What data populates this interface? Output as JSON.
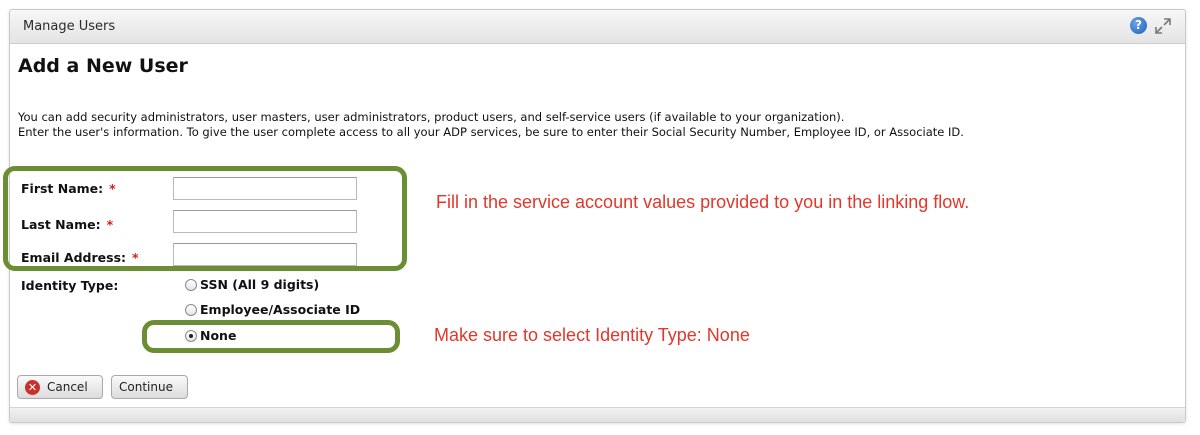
{
  "panel": {
    "title": "Manage Users"
  },
  "icons": {
    "help": "question-circle-icon",
    "expand": "expand-arrows-icon",
    "cancel": "x-circle-icon"
  },
  "page": {
    "heading": "Add a New User",
    "intro_line1": "You can add security administrators, user masters, user administrators, product users, and self-service users (if available to your organization).",
    "intro_line2": "Enter the user's information. To give the user complete access to all your ADP services, be sure to enter their Social Security Number, Employee ID, or Associate ID."
  },
  "form": {
    "first_name": {
      "label": "First Name:",
      "required": "*",
      "value": ""
    },
    "last_name": {
      "label": "Last Name:",
      "required": "*",
      "value": ""
    },
    "email": {
      "label": "Email Address:",
      "required": "*",
      "value": ""
    },
    "identity_type": {
      "label": "Identity Type:",
      "options": [
        "SSN (All 9 digits)",
        "Employee/Associate ID",
        "None"
      ],
      "selected": "None"
    }
  },
  "buttons": {
    "cancel": "Cancel",
    "continue": "Continue"
  },
  "annotations": {
    "note1": "Fill in the service account values provided to you in the linking flow.",
    "note2": "Make sure to select Identity Type: None",
    "note_color": "#e2372b",
    "box_color": "#6b8e34"
  }
}
